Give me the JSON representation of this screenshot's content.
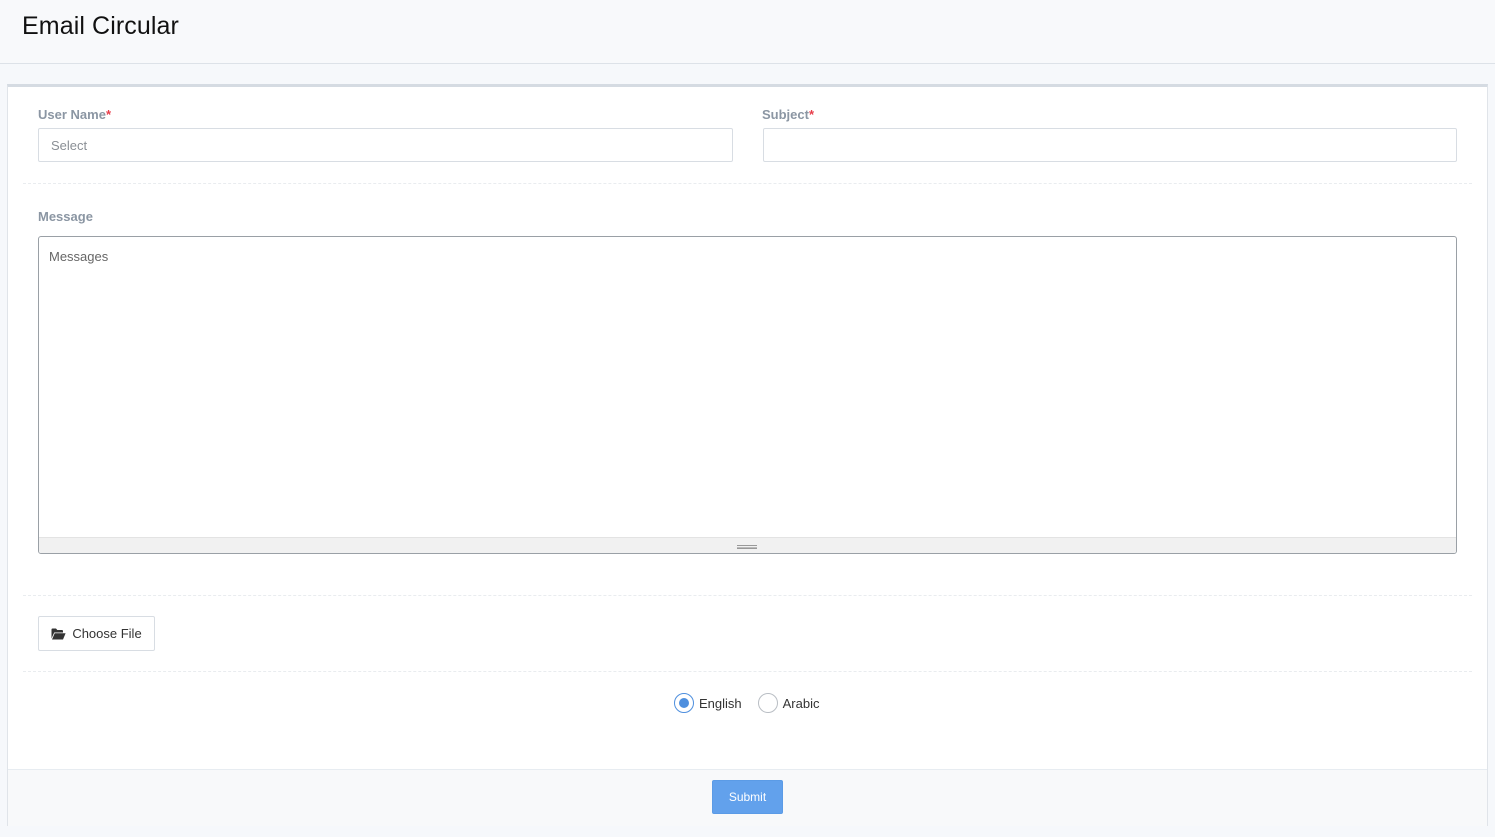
{
  "page": {
    "title": "Email Circular"
  },
  "form": {
    "user_name": {
      "label": "User Name",
      "required_mark": "*",
      "placeholder": "Select"
    },
    "subject": {
      "label": "Subject",
      "required_mark": "*",
      "value": ""
    },
    "message": {
      "label": "Message",
      "placeholder": "Messages"
    },
    "file": {
      "button_label": "Choose File",
      "icon": "folder-open-icon"
    },
    "language": {
      "options": [
        {
          "label": "English",
          "checked": true
        },
        {
          "label": "Arabic",
          "checked": false
        }
      ]
    },
    "submit_label": "Submit"
  },
  "colors": {
    "accent": "#4e8fde",
    "submit_bg": "#62a1ec",
    "required": "#e73d4a",
    "label": "#8b96a3"
  }
}
